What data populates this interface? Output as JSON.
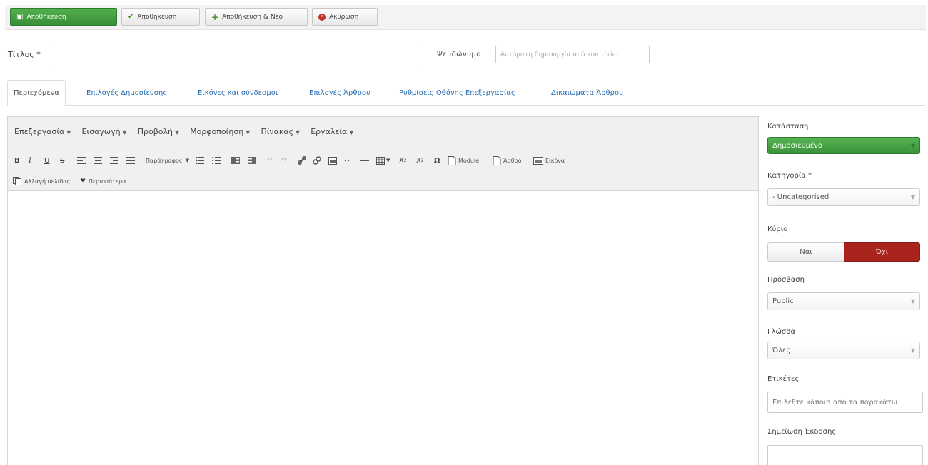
{
  "toolbar": {
    "save": "Αποθήκευση",
    "save_close": "Αποθήκευση",
    "save_new": "Αποθήκευση & Νέο",
    "cancel": "Ακύρωση"
  },
  "form": {
    "title_label": "Τίτλος *",
    "title_value": "",
    "alias_label": "Ψευδώνυμο",
    "alias_placeholder": "Αυτόματη δημιουργία από τον τίτλο"
  },
  "tabs": [
    {
      "label": "Περιεχόμενα",
      "active": true
    },
    {
      "label": "Επιλογές Δημοσίευσης",
      "active": false
    },
    {
      "label": "Εικόνες και σύνδεσμοι",
      "active": false
    },
    {
      "label": "Επιλογές Άρθρου",
      "active": false
    },
    {
      "label": "Ρυθμίσεις Οθόνης Επεξεργασίας",
      "active": false
    },
    {
      "label": "Δικαιώματα Άρθρου",
      "active": false
    }
  ],
  "editor": {
    "menus": [
      "Επεξεργασία",
      "Εισαγωγή",
      "Προβολή",
      "Μορφοποίηση",
      "Πίνακας",
      "Εργαλεία"
    ],
    "paragraph_label": "Παράγραφος",
    "module_label": "Module",
    "article_label": "Άρθρο",
    "image_label": "Εικόνα",
    "pagebreak_label": "Αλλαγή σελίδας",
    "readmore_label": "Περισσότερα",
    "bold": "B",
    "italic": "I",
    "underline": "U",
    "strike": "S",
    "omega": "Ω"
  },
  "sidebar": {
    "status_label": "Κατάσταση",
    "status_value": "Δημοσιευμένο",
    "category_label": "Κατηγορία *",
    "category_value": "- Uncategorised",
    "featured_label": "Κύριο",
    "featured_yes": "Ναι",
    "featured_no": "Όχι",
    "access_label": "Πρόσβαση",
    "access_value": "Public",
    "language_label": "Γλώσσα",
    "language_value": "Όλες",
    "tags_label": "Ετικέτες",
    "tags_placeholder": "Επιλέξτε κάποια από τα παρακάτω",
    "version_note_label": "Σημείωση Έκδοσης"
  },
  "colors": {
    "success": "#46a043",
    "danger": "#a7231c",
    "link": "#2a6fb5"
  }
}
